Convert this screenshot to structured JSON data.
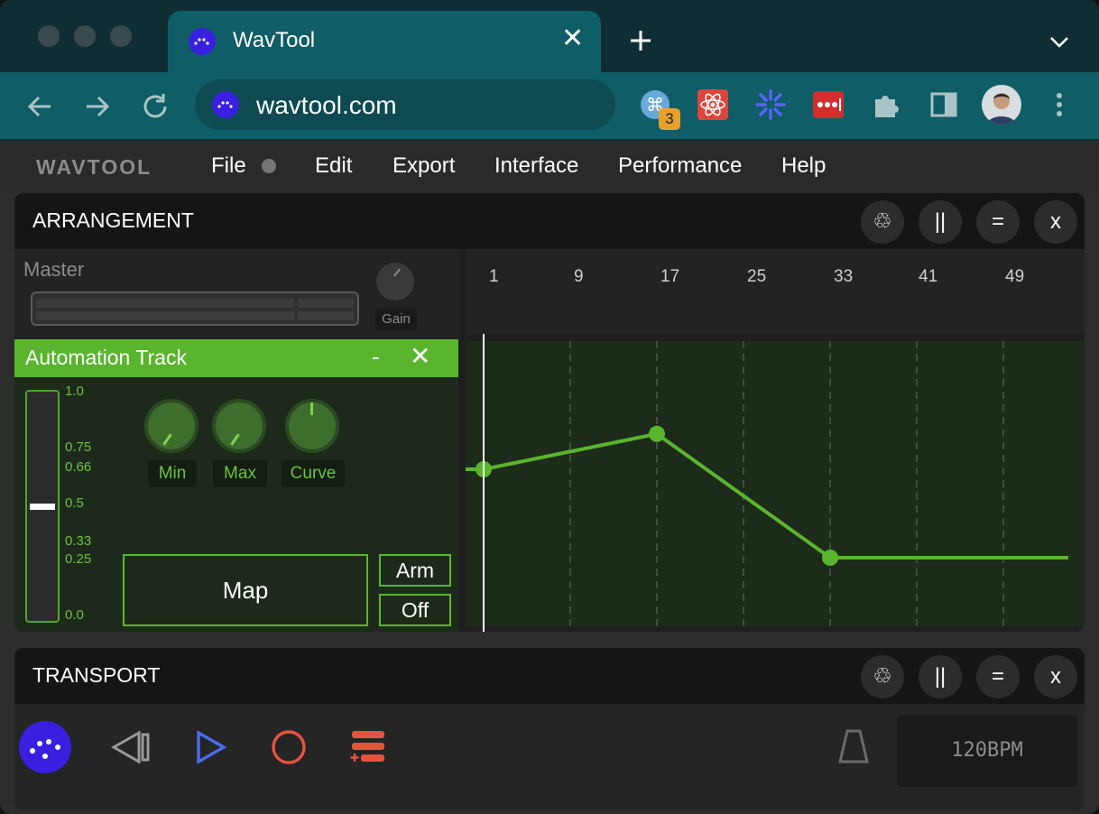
{
  "browser": {
    "tab_title": "WavTool",
    "tab_close": "✕",
    "new_tab": "+",
    "url": "wavtool.com",
    "extension_badge": "3"
  },
  "app": {
    "brand": "WAVTOOL",
    "menu": [
      "File",
      "Edit",
      "Export",
      "Interface",
      "Performance",
      "Help"
    ]
  },
  "arrangement": {
    "title": "ARRANGEMENT",
    "controls": [
      "♲",
      "||",
      "=",
      "x"
    ],
    "master_label": "Master",
    "gain_label": "Gain",
    "ruler_ticks": [
      "1",
      "9",
      "17",
      "25",
      "33",
      "41",
      "49"
    ],
    "track": {
      "title": "Automation Track",
      "minimize": "-",
      "close": "✕",
      "fader_value": 0.5,
      "scale": [
        "1.0",
        "0.75",
        "0.66",
        "0.5",
        "0.33",
        "0.25",
        "0.0"
      ],
      "knobs": [
        "Min",
        "Max",
        "Curve"
      ],
      "map_label": "Map",
      "arm_label": "Arm",
      "off_label": "Off",
      "accent": "#5ab52e"
    },
    "automation_points": [
      {
        "bar": 1,
        "value": 0.6
      },
      {
        "bar": 17,
        "value": 0.74
      },
      {
        "bar": 33,
        "value": 0.25
      },
      {
        "bar": 55,
        "value": 0.25
      }
    ]
  },
  "transport": {
    "title": "TRANSPORT",
    "controls": [
      "♲",
      "||",
      "=",
      "x"
    ],
    "bpm": "120BPM",
    "icons": [
      "wavtool-logo-icon",
      "skip-back-icon",
      "play-icon",
      "record-icon",
      "add-track-icon",
      "metronome-icon"
    ]
  }
}
